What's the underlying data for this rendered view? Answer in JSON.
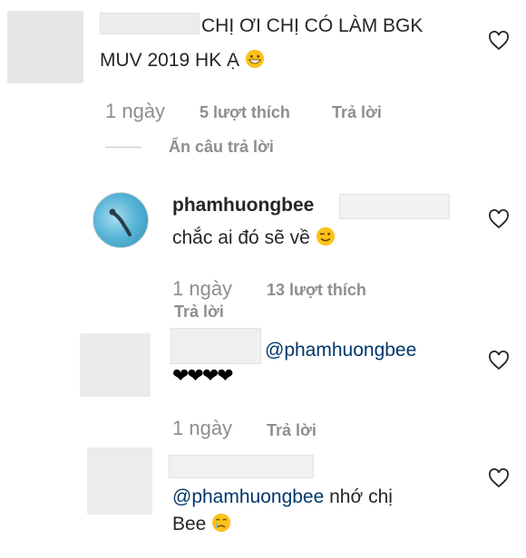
{
  "comments": [
    {
      "text_line1": "CHỊ ƠI CHỊ CÓ LÀM BGK",
      "text_line2": "MUV 2019 HK Ạ",
      "emoji": "grinning-face",
      "time": "1 ngày",
      "likes": "5 lượt thích",
      "reply": "Trả lời",
      "hide_replies": "Ẩn câu trả lời"
    },
    {
      "username": "phamhuongbee",
      "text": "chắc ai đó sẽ về",
      "emoji": "winking-face",
      "time": "1 ngày",
      "likes": "13 lượt thích",
      "reply": "Trả lời"
    },
    {
      "mention": "@phamhuongbee",
      "text": "❤❤❤❤",
      "time": "1 ngày",
      "reply": "Trả lời"
    },
    {
      "mention": "@phamhuongbee",
      "text_after": " nhớ chị",
      "text_line2": "Bee",
      "emoji": "crying-face"
    }
  ],
  "colors": {
    "meta": "#8e8e8e",
    "mention": "#00376b",
    "text": "#262626"
  }
}
